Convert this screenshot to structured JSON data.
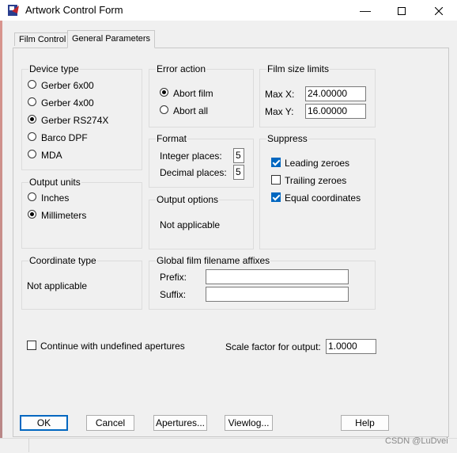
{
  "window": {
    "title": "Artwork Control Form",
    "minimize_glyph": "—",
    "maximize_glyph": "☐",
    "close_glyph": "✕"
  },
  "tabs": [
    {
      "label": "Film Control",
      "active": false
    },
    {
      "label": "General Parameters",
      "active": true
    }
  ],
  "device_type": {
    "title": "Device type",
    "options": [
      {
        "label": "Gerber 6x00",
        "selected": false
      },
      {
        "label": "Gerber 4x00",
        "selected": false
      },
      {
        "label": "Gerber RS274X",
        "selected": true
      },
      {
        "label": "Barco DPF",
        "selected": false
      },
      {
        "label": "MDA",
        "selected": false
      }
    ]
  },
  "error_action": {
    "title": "Error action",
    "options": [
      {
        "label": "Abort film",
        "selected": true
      },
      {
        "label": "Abort all",
        "selected": false
      }
    ]
  },
  "film_size_limits": {
    "title": "Film size limits",
    "max_x_label": "Max X:",
    "max_x_value": "24.00000",
    "max_y_label": "Max Y:",
    "max_y_value": "16.00000"
  },
  "format": {
    "title": "Format",
    "integer_label": "Integer places:",
    "integer_value": "5",
    "decimal_label": "Decimal places:",
    "decimal_value": "5"
  },
  "suppress": {
    "title": "Suppress",
    "options": [
      {
        "label": "Leading zeroes",
        "checked": true
      },
      {
        "label": "Trailing zeroes",
        "checked": false
      },
      {
        "label": "Equal coordinates",
        "checked": true
      }
    ]
  },
  "output_units": {
    "title": "Output units",
    "options": [
      {
        "label": "Inches",
        "selected": false
      },
      {
        "label": "Millimeters",
        "selected": true
      }
    ]
  },
  "output_options": {
    "title": "Output options",
    "text": "Not applicable"
  },
  "coordinate_type": {
    "title": "Coordinate type",
    "text": "Not applicable"
  },
  "affixes": {
    "title": "Global film filename affixes",
    "prefix_label": "Prefix:",
    "prefix_value": "",
    "suffix_label": "Suffix:",
    "suffix_value": ""
  },
  "continue_undefined": {
    "label": "Continue with undefined apertures",
    "checked": false
  },
  "scale_factor": {
    "label": "Scale factor for output:",
    "value": "1.0000"
  },
  "buttons": {
    "ok": "OK",
    "cancel": "Cancel",
    "apertures": "Apertures...",
    "viewlog": "Viewlog...",
    "help": "Help"
  },
  "watermark": "CSDN @LuDvei",
  "colors": {
    "accent": "#0067c0",
    "background": "#f0f0f0"
  }
}
